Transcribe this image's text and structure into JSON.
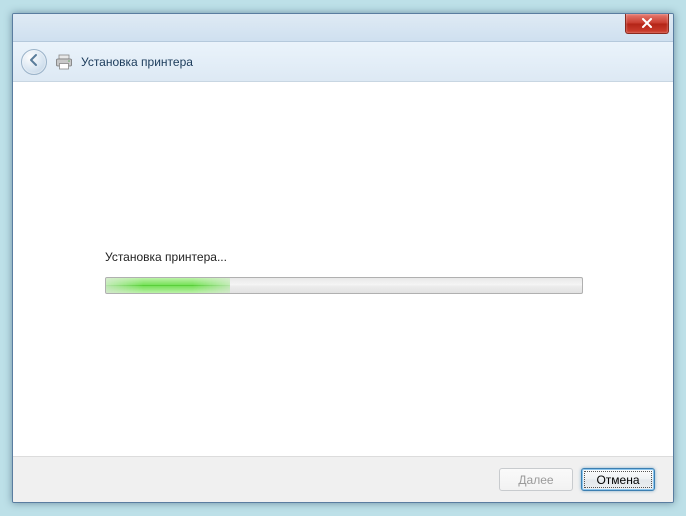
{
  "header": {
    "title": "Установка принтера"
  },
  "content": {
    "status_text": "Установка принтера...",
    "progress_percent": 26
  },
  "footer": {
    "next_label": "Далее",
    "cancel_label": "Отмена"
  },
  "icons": {
    "close": "close-icon",
    "back": "back-arrow-icon",
    "printer": "printer-icon"
  }
}
